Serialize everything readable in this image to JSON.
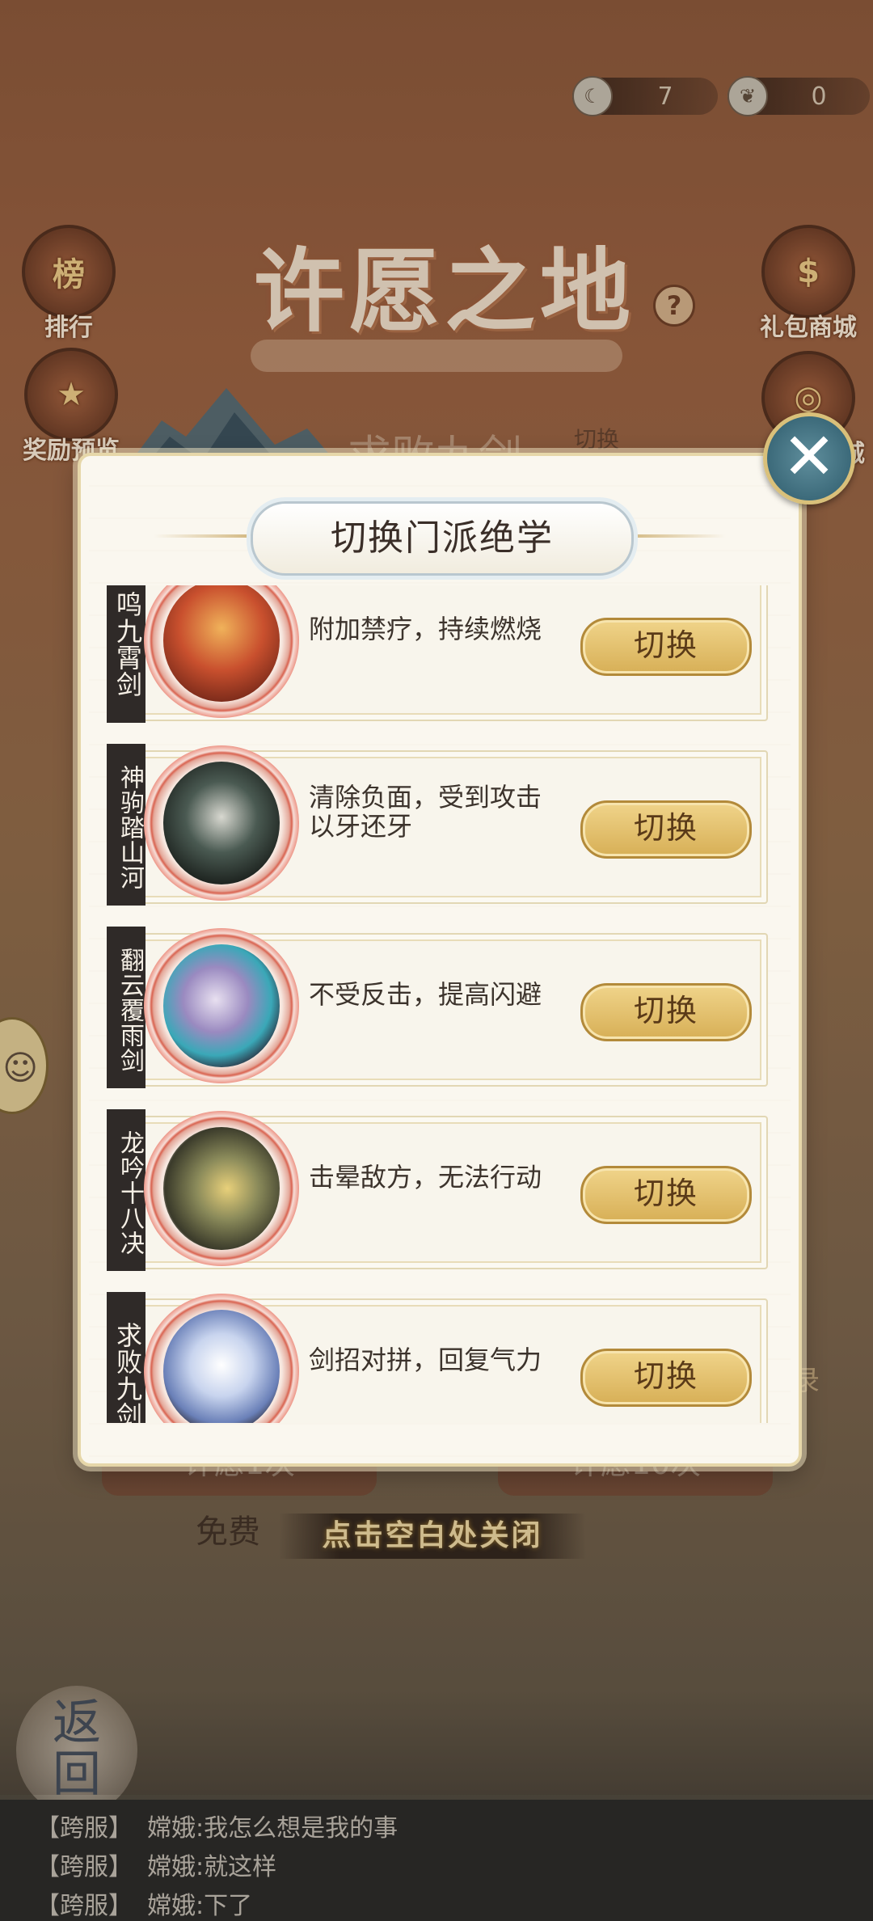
{
  "currency": [
    {
      "icon": "moon-token-icon",
      "value": "7"
    },
    {
      "icon": "ginkgo-leaf-icon",
      "value": "0"
    }
  ],
  "background": {
    "title": "许愿之地",
    "left_buttons": [
      {
        "label": "排行",
        "icon_text": "榜"
      },
      {
        "label": "奖励预览",
        "icon_text": "★"
      }
    ],
    "right_buttons": [
      {
        "label": "礼包商城",
        "icon_text": "$"
      },
      {
        "label": "商城",
        "icon_text": "◎"
      }
    ],
    "behind_text_1": "求败九剑",
    "behind_text_2": "切换",
    "behind_record": "录",
    "wish_once": "许愿1次",
    "wish_ten": "许愿10次",
    "free_label": "免费",
    "close_hint": "点击空白处关闭",
    "back_label": "返回"
  },
  "modal": {
    "title": "切换门派绝学",
    "close_symbol": "✕",
    "skills": [
      {
        "name": "鸣九霄剑",
        "desc": "附加禁疗，持续燃烧",
        "button": "切换",
        "color": "#c9502e"
      },
      {
        "name": "神驹踏山河",
        "desc": "清除负面，受到攻击以牙还牙",
        "button": "切换",
        "color": "#4a5a52"
      },
      {
        "name": "翻云覆雨剑",
        "desc": "不受反击，提高闪避",
        "button": "切换",
        "color": "#7a7aa8"
      },
      {
        "name": "龙吟十八决",
        "desc": "击晕敌方，无法行动",
        "button": "切换",
        "color": "#5a5a3a"
      },
      {
        "name": "求败九剑",
        "desc": "剑招对拼，回复气力",
        "button": "切换",
        "color": "#8aa0c8"
      }
    ]
  },
  "chat": [
    {
      "channel": "【跨服】",
      "sender": "嫦娥:",
      "message": "我怎么想是我的事"
    },
    {
      "channel": "【跨服】",
      "sender": "嫦娥:",
      "message": "就这样"
    },
    {
      "channel": "【跨服】",
      "sender": "嫦娥:",
      "message": "下了"
    }
  ]
}
